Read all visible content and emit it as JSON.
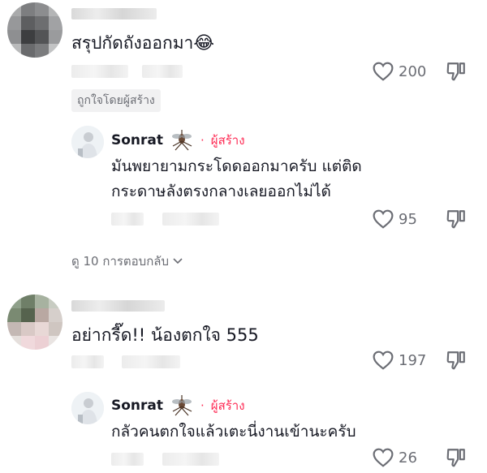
{
  "comments": [
    {
      "text": "สรุปกัดถังออกมา",
      "emoji": "😂",
      "likes": "200",
      "creator_liked_label": "ถูกใจโดยผู้สร้าง",
      "reply": {
        "username": "Sonrat",
        "creator_label": "ผู้สร้าง",
        "text_line1": "มันพยายามกระโดดออกมาครับ แต่ติด",
        "text_line2": "กระดาษลังตรงกลางเลยออกไม่ได้",
        "likes": "95"
      },
      "view_replies_label": "ดู 10 การตอบกลับ"
    },
    {
      "text": "อย่ากรี๊ด!! น้องตกใจ 555",
      "likes": "197",
      "reply": {
        "username": "Sonrat",
        "creator_label": "ผู้สร้าง",
        "text_line1": "กลัวคนตกใจแล้วเตะนี่งานเข้านะครับ",
        "likes": "26"
      }
    }
  ],
  "icons": {
    "like": "heart-outline-icon",
    "dislike": "thumbs-down-icon",
    "creator_badge": "mosquito-icon",
    "expand": "chevron-down-icon"
  },
  "colors": {
    "creator_accent": "#fe2c55",
    "muted_text": "#6b6d74"
  }
}
